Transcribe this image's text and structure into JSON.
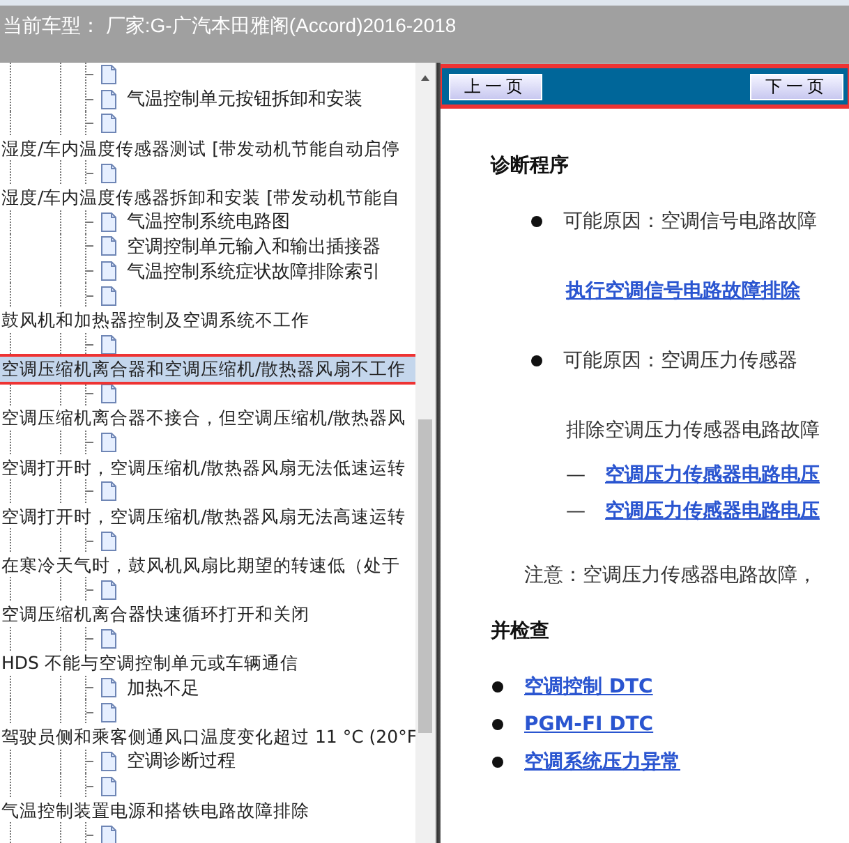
{
  "header": {
    "title": "当前车型： 厂家:G-广汽本田雅阁(Accord)2016-2018"
  },
  "tree": {
    "rows": [
      {
        "kind": "page"
      },
      {
        "kind": "page",
        "label": "气温控制单元按钮拆卸和安装"
      },
      {
        "kind": "page"
      },
      {
        "kind": "title",
        "label": "湿度/车内温度传感器测试 [带发动机节能自动启停",
        "selected": false,
        "highlighted": false
      },
      {
        "kind": "page"
      },
      {
        "kind": "title",
        "label": "湿度/车内温度传感器拆卸和安装 [带发动机节能自",
        "selected": false,
        "highlighted": false
      },
      {
        "kind": "page",
        "label": "气温控制系统电路图"
      },
      {
        "kind": "page",
        "label": "空调控制单元输入和输出插接器"
      },
      {
        "kind": "page",
        "label": "气温控制系统症状故障排除索引"
      },
      {
        "kind": "page"
      },
      {
        "kind": "title",
        "label": "鼓风机和加热器控制及空调系统不工作",
        "selected": false,
        "highlighted": false
      },
      {
        "kind": "page"
      },
      {
        "kind": "title",
        "label": "空调压缩机离合器和空调压缩机/散热器风扇不工作",
        "selected": true,
        "highlighted": true
      },
      {
        "kind": "page"
      },
      {
        "kind": "title",
        "label": "空调压缩机离合器不接合，但空调压缩机/散热器风",
        "selected": false,
        "highlighted": false
      },
      {
        "kind": "page"
      },
      {
        "kind": "title",
        "label": "空调打开时，空调压缩机/散热器风扇无法低速运转",
        "selected": false,
        "highlighted": false
      },
      {
        "kind": "page"
      },
      {
        "kind": "title",
        "label": "空调打开时，空调压缩机/散热器风扇无法高速运转",
        "selected": false,
        "highlighted": false
      },
      {
        "kind": "page"
      },
      {
        "kind": "title",
        "label": "在寒冷天气时，鼓风机风扇比期望的转速低（处于",
        "selected": false,
        "highlighted": false
      },
      {
        "kind": "page"
      },
      {
        "kind": "title",
        "label": "空调压缩机离合器快速循环打开和关闭",
        "selected": false,
        "highlighted": false
      },
      {
        "kind": "page"
      },
      {
        "kind": "title",
        "label": "HDS 不能与空调控制单元或车辆通信",
        "selected": false,
        "highlighted": false
      },
      {
        "kind": "page",
        "label": "加热不足"
      },
      {
        "kind": "page"
      },
      {
        "kind": "title",
        "label": "驾驶员侧和乘客侧通风口温度变化超过 11 °C (20°F",
        "selected": false,
        "highlighted": false
      },
      {
        "kind": "page",
        "label": "空调诊断过程"
      },
      {
        "kind": "page"
      },
      {
        "kind": "title",
        "label": "气温控制装置电源和搭铁电路故障排除",
        "selected": false,
        "highlighted": false
      },
      {
        "kind": "page"
      }
    ]
  },
  "nav": {
    "highlighted": true,
    "prev": "上一页",
    "next": "下一页"
  },
  "content": [
    {
      "kind": "heading",
      "text": "诊断程序"
    },
    {
      "kind": "bullet",
      "text": "可能原因：空调信号电路故障"
    },
    {
      "kind": "link",
      "text": "执行空调信号电路故障排除"
    },
    {
      "kind": "bullet",
      "text": "可能原因：空调压力传感器"
    },
    {
      "kind": "text",
      "text": "排除空调压力传感器电路故障"
    },
    {
      "kind": "dashlink",
      "dash": "—",
      "text": "空调压力传感器电路电压"
    },
    {
      "kind": "dashlink",
      "dash": "—",
      "text": "空调压力传感器电路电压"
    },
    {
      "kind": "note",
      "text": "注意：空调压力传感器电路故障，"
    },
    {
      "kind": "heading",
      "text": "并检查"
    },
    {
      "kind": "bulletlink",
      "text": "空调控制 DTC"
    },
    {
      "kind": "bulletlink",
      "text": "PGM-FI DTC"
    },
    {
      "kind": "bulletlink",
      "text": "空调系统压力异常"
    }
  ]
}
